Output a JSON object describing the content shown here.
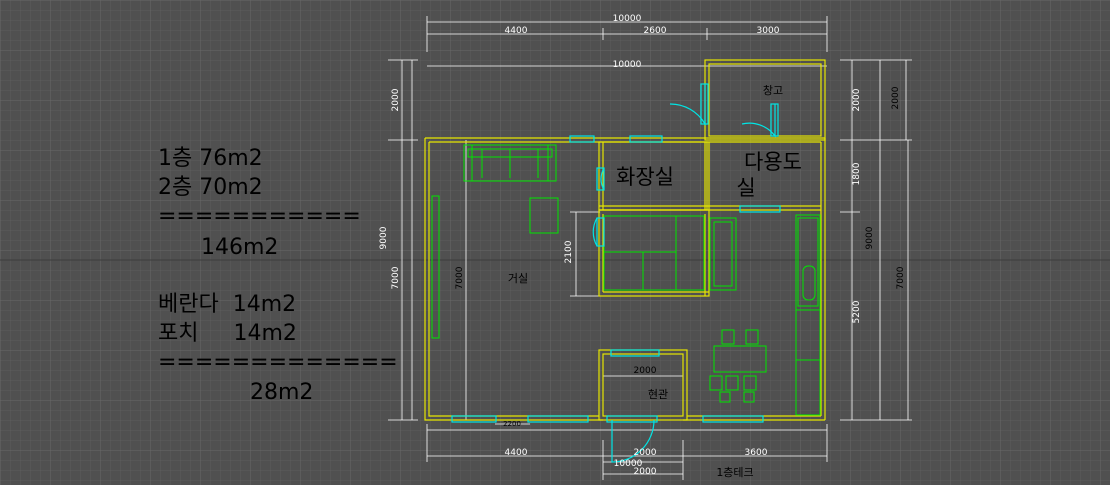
{
  "area_summary": {
    "floor1": "1층 76m2",
    "floor2": "2층 70m2",
    "separator1": "===========",
    "subtotal1": "146m2",
    "veranda": "베란다  14m2",
    "porch": "포치     14m2",
    "separator2": "=============",
    "subtotal2": "28m2"
  },
  "rooms": {
    "storage": "창고",
    "bathroom": "화장실",
    "utility_line1": "다용도",
    "utility_line2": "실",
    "living": "거실",
    "entrance": "현관",
    "deck": "1층테크"
  },
  "dimensions": {
    "top_total": "10000",
    "top_left": "4400",
    "top_mid": "2600",
    "top_right": "3000",
    "inner_top_total": "10000",
    "left_upper": "2000",
    "left_total": "9000",
    "left_lower": "7000",
    "living_height": "7000",
    "bath_block_height": "2100",
    "right_upper": "2000",
    "right_upper_outer": "2000",
    "right_mid": "1800",
    "right_total": "9000",
    "right_lower": "5200",
    "right_lower_outer": "7000",
    "entrance_width": "2000",
    "bottom_left": "4400",
    "bottom_mid": "2000",
    "bottom_right": "3600",
    "bottom_total": "10000",
    "deck_width": "2000",
    "bottom_small": "2200"
  },
  "colors": {
    "background": "#505050",
    "grid": "#5e5e5e",
    "grid_major": "#6a6a6a",
    "wall": "#e6e600",
    "furniture": "#00e600",
    "door": "#00e5e5",
    "dimension": "#ffffff",
    "text": "#000000"
  }
}
